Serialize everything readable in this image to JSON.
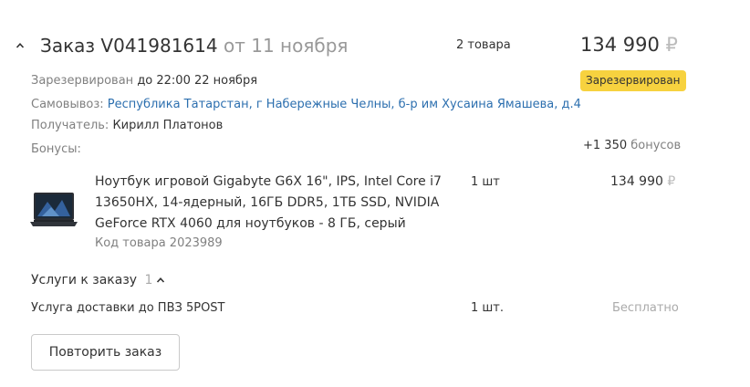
{
  "order": {
    "title": "Заказ V041981614",
    "date": "от 11 ноября",
    "items_count": "2 товара",
    "total": "134 990",
    "currency": "₽",
    "status_badge": "Зарезервирован"
  },
  "reserve": {
    "label": "Зарезервирован",
    "value": "до 22:00 22 ноября"
  },
  "pickup": {
    "label": "Самовывоз:",
    "address": "Республика Татарстан, г Набережные Челны, б-р им Хусаина Ямашева, д.4"
  },
  "recipient": {
    "label": "Получатель:",
    "name": "Кирилл Платонов"
  },
  "bonus": {
    "label": "Бонусы:",
    "amount": "+1 350",
    "unit": "бонусов"
  },
  "product": {
    "name": "Ноутбук игровой Gigabyte G6X 16\", IPS, Intel Core i7 13650HX, 14-ядерный, 16ГБ DDR5, 1ТБ SSD, NVIDIA GeForce RTX 4060 для ноутбуков - 8 ГБ, серый",
    "code": "Код товара 2023989",
    "qty": "1 шт",
    "price": "134 990",
    "currency": "₽",
    "image_icon": "laptop-icon"
  },
  "services": {
    "title": "Услуги к заказу",
    "count": "1",
    "items": [
      {
        "name": "Услуга доставки до ПВЗ 5POST",
        "qty": "1 шт.",
        "price": "Бесплатно"
      }
    ]
  },
  "repeat_button": "Повторить заказ",
  "colors": {
    "badge": "#f7d23f",
    "link": "#2c6faf",
    "muted": "#999999"
  }
}
